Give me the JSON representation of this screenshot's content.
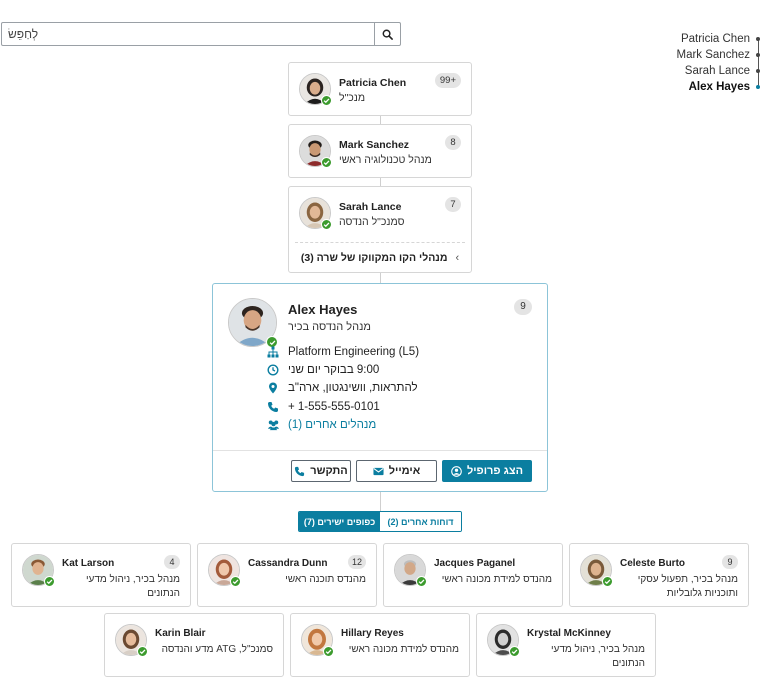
{
  "search": {
    "placeholder": "לְחַפֵּשׂ"
  },
  "breadcrumb": [
    {
      "name": "Patricia Chen"
    },
    {
      "name": "Mark Sanchez"
    },
    {
      "name": "Sarah Lance"
    },
    {
      "name": "Alex Hayes",
      "current": true
    }
  ],
  "managers": [
    {
      "name": "Patricia Chen",
      "title": "מנכ\"ל",
      "count": "99+"
    },
    {
      "name": "Mark Sanchez",
      "title": "מנהל טכנולוגיה ראשי",
      "count": "8"
    },
    {
      "name": "Sarah Lance",
      "title": "סמנכ\"ל הנדסה",
      "count": "7"
    }
  ],
  "peers_link": {
    "label": "מנהלי הקו המקווקו של שרה (3)"
  },
  "focus": {
    "name": "Alex Hayes",
    "title": "מנהל הנדסה בכיר",
    "count": "9",
    "department": "Platform Engineering (L5)",
    "time": "9:00 בבוקר יום שני",
    "location": "להתראות, וושינגטון, ארה\"ב",
    "phone": "+ 1-555-555-0101",
    "other_managers": "מנהלים אחרים (1)",
    "buttons": {
      "call": "התקשר",
      "email": "אימייל",
      "profile": "הצג פרופיל"
    }
  },
  "tabs": [
    {
      "label": "כפופים ישירים (7)",
      "active": true
    },
    {
      "label": "דוחות אחרים (2)",
      "active": false
    }
  ],
  "reports": [
    {
      "name": "Kat Larson",
      "title": "מנהל בכיר, ניהול מדעי הנתונים",
      "count": "4"
    },
    {
      "name": "Cassandra Dunn",
      "title": "מהנדס תוכנה ראשי",
      "count": "12"
    },
    {
      "name": "Jacques Paganel",
      "title": "מהנדס למידת מכונה ראשי",
      "count": ""
    },
    {
      "name": "Celeste Burto",
      "title": "מנהל בכיר, תפעול עסקי ותוכניות גלובליות",
      "count": "9"
    },
    {
      "name": "Karin Blair",
      "title": "סמנכ\"ל, ATG מדע והנדסה",
      "count": ""
    },
    {
      "name": "Hillary Reyes",
      "title": "מהנדס למידת מכונה ראשי",
      "count": ""
    },
    {
      "name": "Krystal McKinney",
      "title": "מנהל בכיר, ניהול מדעי הנתונים",
      "count": ""
    }
  ],
  "colors": {
    "accent": "#0b7ea0",
    "status_online": "#3c9b2e"
  },
  "icons": [
    "search-icon",
    "org-chart-icon",
    "clock-icon",
    "location-pin-icon",
    "phone-icon",
    "users-icon",
    "envelope-icon",
    "user-circle-icon",
    "chevron-left-icon",
    "check-icon"
  ]
}
